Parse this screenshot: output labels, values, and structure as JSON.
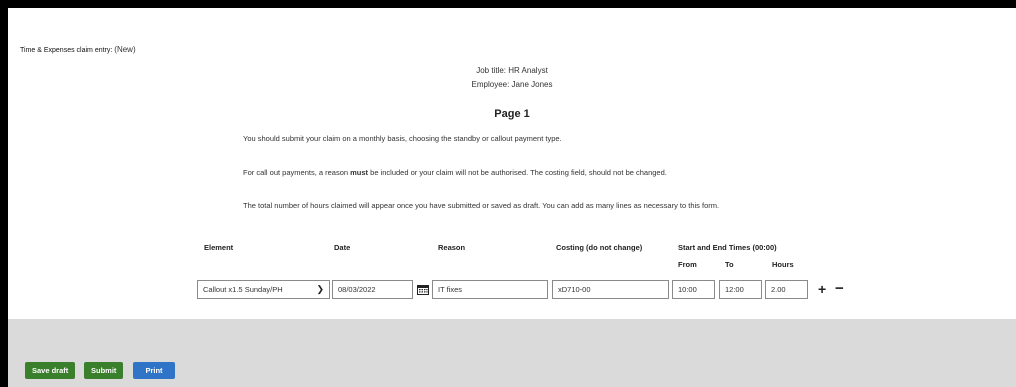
{
  "header": {
    "entry_label": "Time & Expenses claim entry:",
    "entry_state": "(New)"
  },
  "info": {
    "job_title": "Job title: HR Analyst",
    "employee": "Employee: Jane Jones"
  },
  "page": {
    "heading": "Page 1",
    "paragraph1": "You should submit your claim on a monthly basis, choosing the standby or callout payment type.",
    "paragraph2_pre": "For call out payments, a reason ",
    "paragraph2_bold": "must",
    "paragraph2_post": " be included or your claim will not be authorised. The costing field, should not be changed.",
    "paragraph3": "The total number of hours claimed will appear once you have submitted or saved as draft. You can add as many lines as necessary to this form."
  },
  "table": {
    "headers": {
      "element": "Element",
      "date": "Date",
      "reason": "Reason",
      "costing": "Costing (do not change)",
      "times": "Start and End Times (00:00)",
      "from": "From",
      "to": "To",
      "hours": "Hours"
    },
    "row": {
      "element": "Callout x1.5 Sunday/PH",
      "date": "08/03/2022",
      "reason": "IT fixes",
      "costing": "xD710-00",
      "from": "10:00",
      "to": "12:00",
      "hours": "2.00"
    },
    "add_symbol": "+",
    "remove_symbol": "−"
  },
  "footer": {
    "save_draft": "Save draft",
    "submit": "Submit",
    "print": "Print"
  },
  "colors": {
    "green_button": "#3a7f2c",
    "blue_button": "#2f74c6",
    "footer_bg": "#dadada"
  }
}
